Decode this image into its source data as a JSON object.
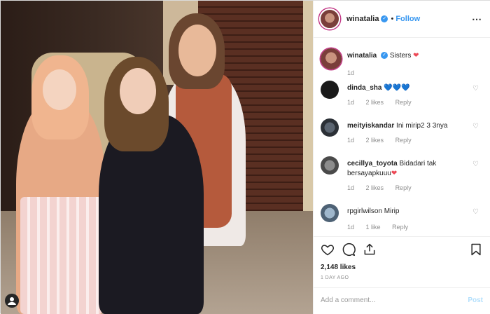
{
  "header": {
    "username": "winatalia",
    "verified_icon": "verified-badge-icon",
    "separator": "•",
    "follow_label": "Follow",
    "more_icon": "more-options-icon"
  },
  "caption": {
    "username": "winatalia",
    "text": "Sisters",
    "emoji": "❤",
    "time": "1d"
  },
  "comments": [
    {
      "username": "dinda_sha",
      "text": "💙💙💙",
      "time": "1d",
      "likes": "2 likes",
      "reply": "Reply"
    },
    {
      "username": "meityiskandar",
      "text": "Ini mirip2 3 3nya",
      "time": "1d",
      "likes": "2 likes",
      "reply": "Reply"
    },
    {
      "username": "cecillya_toyota",
      "text": "Bidadari tak bersayapkuuu",
      "emoji": "❤",
      "time": "1d",
      "likes": "2 likes",
      "reply": "Reply"
    },
    {
      "username": "rpgirlwilson",
      "text": "Mirip",
      "time": "1d",
      "likes": "1 like",
      "reply": "Reply"
    }
  ],
  "actions": {
    "likes": "2,148 likes",
    "time_ago": "1 DAY AGO"
  },
  "add_comment": {
    "placeholder": "Add a comment...",
    "post_label": "Post"
  },
  "colors": {
    "accent_blue": "#3897f0",
    "heart_red": "#ed4956",
    "muted_text": "#8e8e8e",
    "post_disabled": "#b2dffc"
  }
}
